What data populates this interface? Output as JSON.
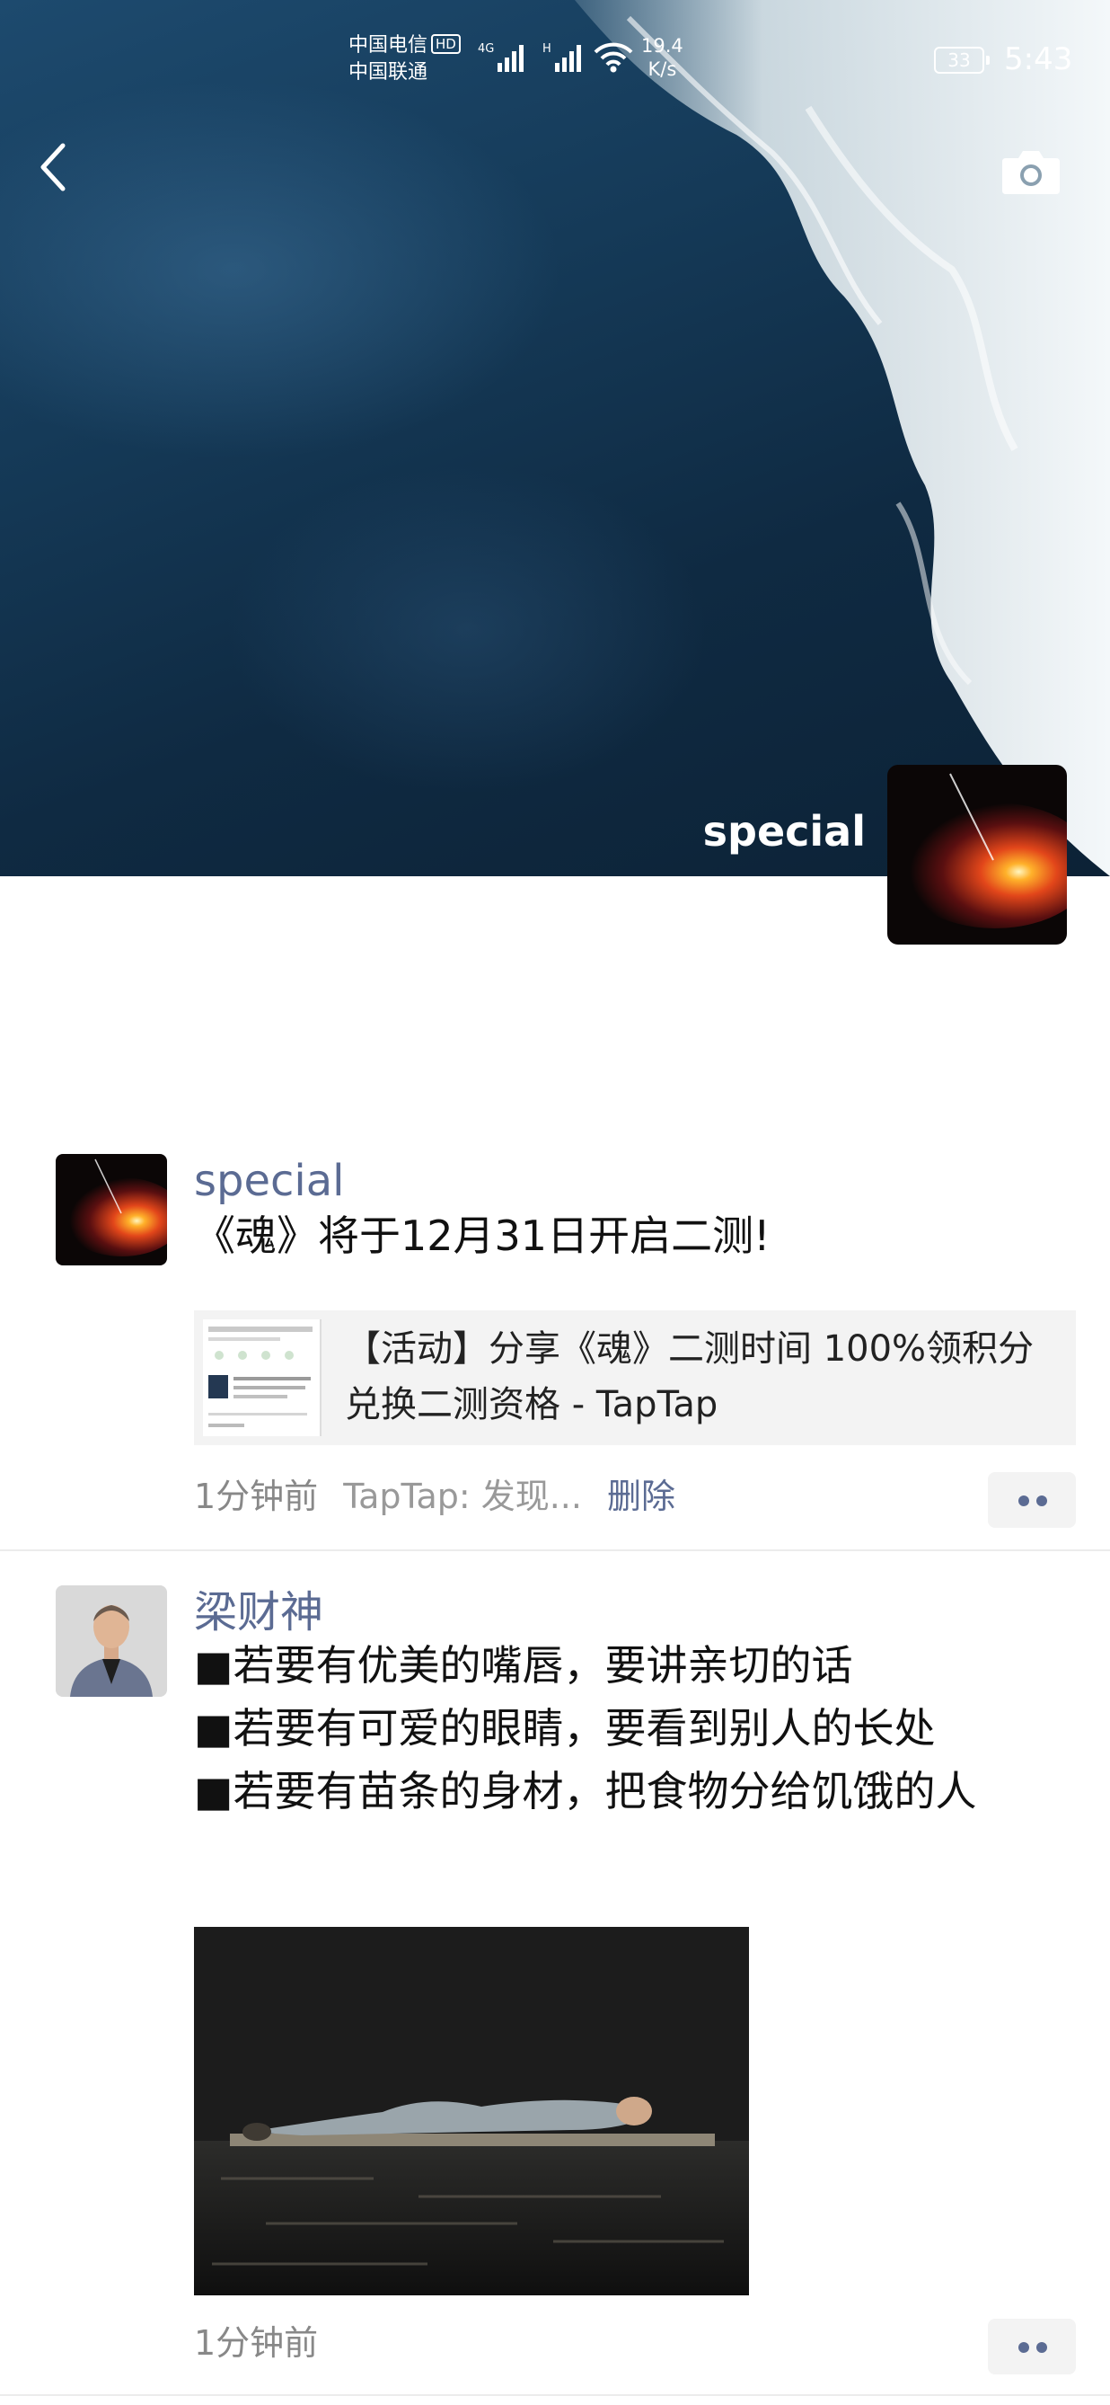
{
  "status_bar": {
    "carrier1": "中国电信",
    "hd": "HD",
    "carrier2": "中国联通",
    "net1": "4G",
    "net2": "H",
    "speed_value": "19.4",
    "speed_unit": "K/s",
    "battery": "33",
    "time": "5:43"
  },
  "header": {
    "cover_name": "special"
  },
  "posts": [
    {
      "name": "special",
      "text": "《魂》将于12月31日开启二测!",
      "link_text": "【活动】分享《魂》二测时间 100%领积分兑换二测资格 - TapTap",
      "time": "1分钟前",
      "source": "TapTap: 发现...",
      "delete_label": "删除"
    },
    {
      "name": "梁财神",
      "lines": [
        "■若要有优美的嘴唇，要讲亲切的话",
        "■若要有可爱的眼睛，要看到别人的长处",
        "■若要有苗条的身材，把食物分给饥饿的人"
      ],
      "time": "1分钟前"
    }
  ],
  "icons": {
    "back": "back-chevron-icon",
    "camera": "camera-icon",
    "more": "more-dots-icon"
  },
  "colors": {
    "name_blue": "#5b6b93",
    "meta_gray": "#888888"
  }
}
